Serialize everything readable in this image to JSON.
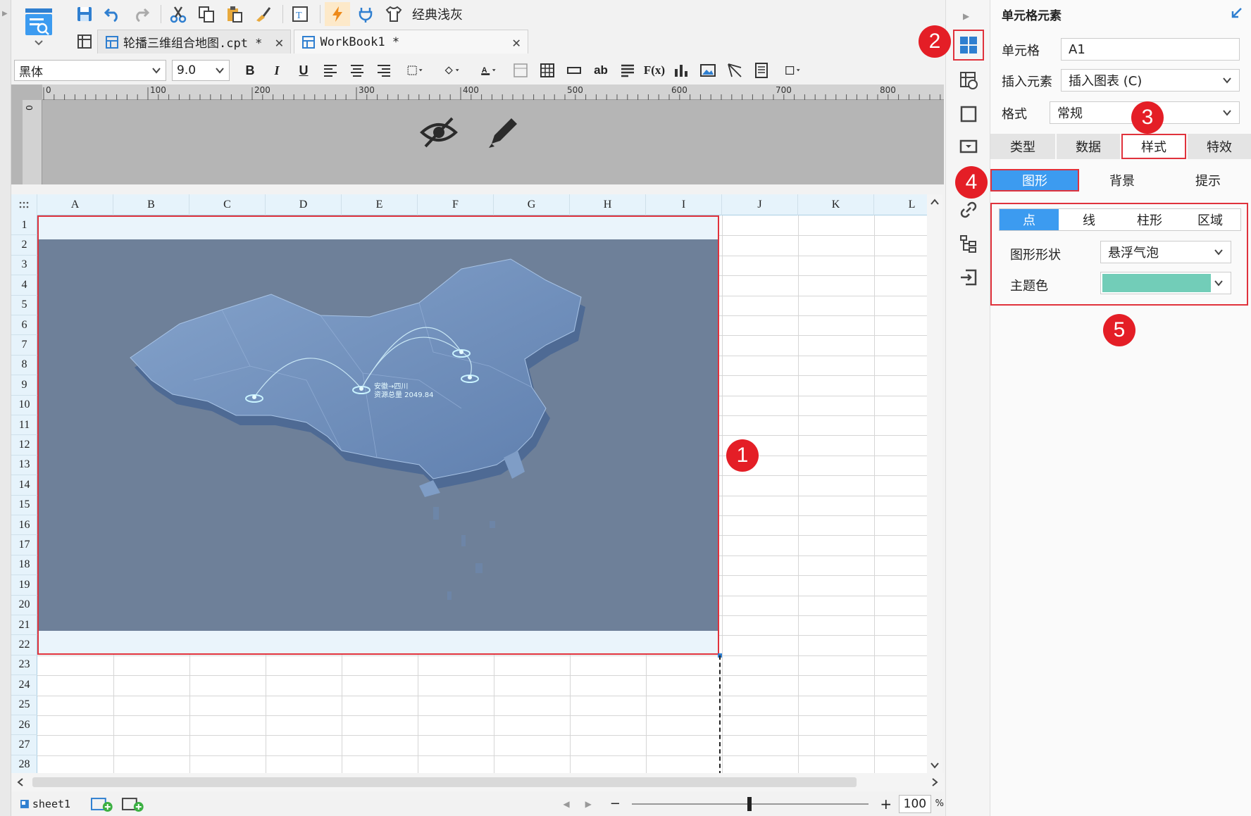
{
  "toolbar": {
    "theme_label": "经典浅灰"
  },
  "tabs": [
    {
      "label": "轮播三维组合地图.cpt *"
    },
    {
      "label": "WorkBook1 *"
    }
  ],
  "format_bar": {
    "font_family": "黑体",
    "font_size": "9.0",
    "bold": "B",
    "italic": "I",
    "underline": "U",
    "text_ab": "ab",
    "formula": "F(x)"
  },
  "ruler": {
    "ticks": [
      "0",
      "100",
      "200",
      "300",
      "400",
      "500",
      "600",
      "700",
      "800"
    ],
    "vertical": "0"
  },
  "grid": {
    "columns": [
      "A",
      "B",
      "C",
      "D",
      "E",
      "F",
      "G",
      "H",
      "I",
      "J",
      "K",
      "L"
    ],
    "rows": [
      "1",
      "2",
      "3",
      "4",
      "5",
      "6",
      "7",
      "8",
      "9",
      "10",
      "11",
      "12",
      "13",
      "14",
      "15",
      "16",
      "17",
      "18",
      "19",
      "20",
      "21",
      "22",
      "23",
      "24",
      "25",
      "26",
      "27",
      "28"
    ]
  },
  "map": {
    "label_line1": "安徽→四川",
    "label_line2": "资源总量 2049.84"
  },
  "bottom": {
    "sheet": "sheet1",
    "zoom": "100",
    "percent": "%",
    "minus": "−",
    "plus": "+"
  },
  "panel": {
    "title": "单元格元素",
    "cell_label": "单元格",
    "cell_value": "A1",
    "insert_label": "插入元素",
    "insert_value": "插入图表 (C)",
    "format_label": "格式",
    "format_value": "常规",
    "main_tabs": [
      "类型",
      "数据",
      "样式",
      "特效"
    ],
    "sub_tabs": [
      "图形",
      "背景",
      "提示"
    ],
    "shape_tabs": [
      "点",
      "线",
      "柱形",
      "区域"
    ],
    "shape_label": "图形形状",
    "shape_value": "悬浮气泡",
    "theme_label": "主题色",
    "theme_color": "#72cdb8"
  },
  "badges": [
    "1",
    "2",
    "3",
    "4",
    "5"
  ],
  "colors": {
    "accent": "#3c9bf0",
    "highlight": "#e0323c",
    "header_bg": "#e6f3fb"
  }
}
